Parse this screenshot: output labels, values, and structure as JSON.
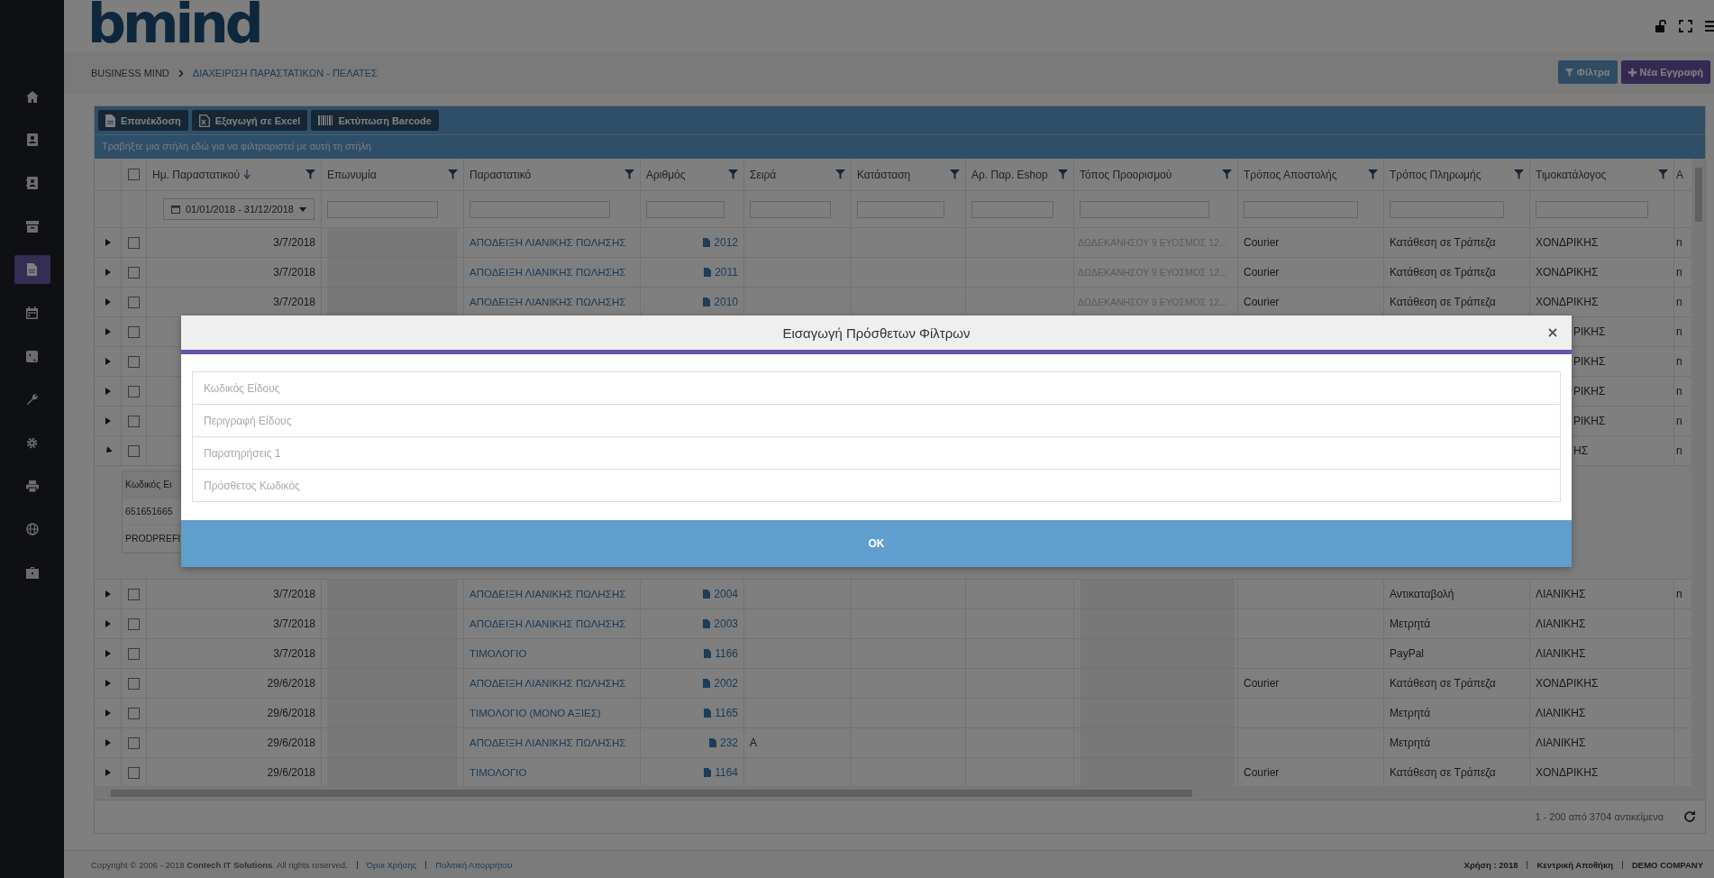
{
  "logo": "bmind",
  "sidebar": [
    {
      "selected": false
    },
    {
      "selected": false
    },
    {
      "selected": false
    },
    {
      "selected": false
    },
    {
      "selected": true
    },
    {
      "selected": false
    },
    {
      "selected": false
    },
    {
      "selected": false
    },
    {
      "selected": false
    },
    {
      "selected": false
    },
    {
      "selected": false
    },
    {
      "selected": false
    }
  ],
  "breadcrumb": [
    "BUSINESS MIND",
    "ΔΙΑΧΕΙΡΙΣΗ ΠΑΡΑΣΤΑΤΙΚΩΝ - ΠΕΛΑΤΕΣ"
  ],
  "actions": [
    {
      "kind": "filter",
      "label": "Φίλτρα"
    },
    {
      "kind": "new",
      "label": "Νέα Εγγραφή"
    }
  ],
  "toolbar": [
    {
      "label": "Επανέκδοση"
    },
    {
      "label": "Εξαγωγή σε Excel"
    },
    {
      "label": "Εκτύπωση Barcode"
    }
  ],
  "group_hint": "Τραβήξτε μια στήλη εδώ για να φιλτραριστεί με αυτή τη στήλη",
  "all_checked": false,
  "date_filter": "01/01/2018 - 31/12/2018",
  "columns": [
    {
      "kind": "date",
      "label": "Ημ. Παραστατικού",
      "sorted": true
    },
    {
      "kind": "name",
      "label": "Επωνυμία",
      "sorted": false
    },
    {
      "kind": "link",
      "label": "Παραστατικό",
      "sorted": false
    },
    {
      "kind": "number",
      "label": "Αριθμός",
      "sorted": false
    },
    {
      "kind": "text",
      "label": "Σειρά",
      "sorted": false
    },
    {
      "kind": "text",
      "label": "Κατάσταση",
      "sorted": false
    },
    {
      "kind": "text",
      "label": "Αρ. Παρ. Eshop",
      "sorted": false
    },
    {
      "kind": "address",
      "label": "Τόπος Προορισμού",
      "sorted": false
    },
    {
      "kind": "text",
      "label": "Τρόπος Αποστολής",
      "sorted": false
    },
    {
      "kind": "text",
      "label": "Τρόπος Πληρωμής",
      "sorted": false
    },
    {
      "kind": "text",
      "label": "Τιμοκατάλογος",
      "sorted": false
    },
    {
      "kind": "cut",
      "label": "Α",
      "sorted": false
    }
  ],
  "rows": [
    {
      "kind": "row",
      "expanded": false,
      "checked": false,
      "cells": [
        "3/7/2018",
        null,
        "ΑΠΟΔΕΙΞΗ ΛΙΑΝΙΚΗΣ ΠΩΛΗΣΗΣ",
        "2012",
        null,
        null,
        null,
        "ΔΩΔΕΚΑΝΗΣΟΥ 9 ΕΥΟΣΜΟΣ 12...",
        "Courier",
        "Κατάθεση σε Τράπεζα",
        "ΧΟΝΔΡΙΚΗΣ",
        "n"
      ]
    },
    {
      "kind": "row",
      "expanded": false,
      "checked": false,
      "cells": [
        "3/7/2018",
        null,
        "ΑΠΟΔΕΙΞΗ ΛΙΑΝΙΚΗΣ ΠΩΛΗΣΗΣ",
        "2011",
        null,
        null,
        null,
        "ΔΩΔΕΚΑΝΗΣΟΥ 9 ΕΥΟΣΜΟΣ 12...",
        "Courier",
        "Κατάθεση σε Τράπεζα",
        "ΧΟΝΔΡΙΚΗΣ",
        "n"
      ]
    },
    {
      "kind": "row",
      "expanded": false,
      "checked": false,
      "cells": [
        "3/7/2018",
        null,
        "ΑΠΟΔΕΙΞΗ ΛΙΑΝΙΚΗΣ ΠΩΛΗΣΗΣ",
        "2010",
        null,
        null,
        null,
        "ΔΩΔΕΚΑΝΗΣΟΥ 9 ΕΥΟΣΜΟΣ 12...",
        "Courier",
        "Κατάθεση σε Τράπεζα",
        "ΧΟΝΔΡΙΚΗΣ",
        "n"
      ]
    },
    {
      "kind": "covered",
      "expanded": false,
      "checked": false,
      "cells": [
        null,
        null,
        null,
        null,
        null,
        null,
        null,
        null,
        null,
        null,
        "ΡΙΚΗΣ",
        "n"
      ]
    },
    {
      "kind": "covered",
      "expanded": false,
      "checked": false,
      "cells": [
        null,
        null,
        null,
        null,
        null,
        null,
        null,
        null,
        null,
        null,
        "ΡΙΚΗΣ",
        "n"
      ]
    },
    {
      "kind": "covered",
      "expanded": false,
      "checked": false,
      "cells": [
        null,
        null,
        null,
        null,
        null,
        null,
        null,
        null,
        null,
        null,
        "ΡΙΚΗΣ",
        "n"
      ]
    },
    {
      "kind": "covered",
      "expanded": false,
      "checked": false,
      "cells": [
        null,
        null,
        null,
        null,
        null,
        null,
        null,
        null,
        null,
        null,
        "ΡΙΚΗΣ",
        "n"
      ]
    },
    {
      "kind": "covered",
      "expanded": true,
      "checked": false,
      "cells": [
        null,
        null,
        null,
        null,
        null,
        null,
        null,
        null,
        null,
        null,
        "ΗΣ",
        "n"
      ]
    },
    {
      "kind": "detail",
      "header": "Κωδικός Ει",
      "cells": [
        "651651665",
        "PRODPREFI"
      ]
    },
    {
      "kind": "row",
      "expanded": false,
      "checked": false,
      "cells": [
        "3/7/2018",
        null,
        "ΑΠΟΔΕΙΞΗ ΛΙΑΝΙΚΗΣ ΠΩΛΗΣΗΣ",
        "2004",
        null,
        null,
        null,
        null,
        null,
        "Αντικαταβολή",
        "ΛΙΑΝΙΚΗΣ",
        "n"
      ]
    },
    {
      "kind": "row",
      "expanded": false,
      "checked": false,
      "cells": [
        "3/7/2018",
        null,
        "ΑΠΟΔΕΙΞΗ ΛΙΑΝΙΚΗΣ ΠΩΛΗΣΗΣ",
        "2003",
        null,
        null,
        null,
        null,
        null,
        "Μετρητά",
        "ΛΙΑΝΙΚΗΣ",
        null
      ]
    },
    {
      "kind": "row",
      "expanded": false,
      "checked": false,
      "cells": [
        "3/7/2018",
        null,
        "ΤΙΜΟΛΟΓΙΟ",
        "1166",
        null,
        null,
        null,
        null,
        null,
        "PayPal",
        "ΛΙΑΝΙΚΗΣ",
        null
      ]
    },
    {
      "kind": "row",
      "expanded": false,
      "checked": false,
      "cells": [
        "29/6/2018",
        null,
        "ΑΠΟΔΕΙΞΗ ΛΙΑΝΙΚΗΣ ΠΩΛΗΣΗΣ",
        "2002",
        null,
        null,
        null,
        null,
        "Courier",
        "Κατάθεση σε Τράπεζα",
        "ΧΟΝΔΡΙΚΗΣ",
        null
      ]
    },
    {
      "kind": "row",
      "expanded": false,
      "checked": false,
      "cells": [
        "29/6/2018",
        null,
        "ΤΙΜΟΛΟΓΙΟ (ΜΟΝΟ ΑΞΙΕΣ)",
        "1165",
        null,
        null,
        null,
        null,
        null,
        "Μετρητά",
        "ΛΙΑΝΙΚΗΣ",
        null
      ]
    },
    {
      "kind": "row",
      "expanded": false,
      "checked": false,
      "cells": [
        "29/6/2018",
        null,
        "ΑΠΟΔΕΙΞΗ ΛΙΑΝΙΚΗΣ ΠΩΛΗΣΗΣ",
        "232",
        "A",
        null,
        null,
        null,
        null,
        "Μετρητά",
        "ΛΙΑΝΙΚΗΣ",
        null
      ]
    },
    {
      "kind": "row",
      "expanded": false,
      "checked": false,
      "cells": [
        "29/6/2018",
        null,
        "ΤΙΜΟΛΟΓΙΟ",
        "1164",
        null,
        null,
        null,
        null,
        "Courier",
        "Κατάθεση σε Τράπεζα",
        "ΧΟΝΔΡΙΚΗΣ",
        null
      ]
    }
  ],
  "pager": "1 - 200 από 3704 αντικείμενα",
  "footer": {
    "copyright": "Copyright © 2006 - 2018 **Contech IT Solutions**. All rights reserved.",
    "links": [
      "Όροι Χρήσης",
      "Πολιτική Απορρήτου"
    ],
    "info": [
      "Χρήση : 2018",
      "Κεντρική Αποθήκη",
      "DEMO COMPANY"
    ]
  },
  "modal": {
    "title": "Εισαγωγή Πρόσθετων Φίλτρων",
    "fields": [
      {
        "placeholder": "Κωδικός Είδους"
      },
      {
        "placeholder": "Περιγραφή Είδους"
      },
      {
        "placeholder": "Παρατηρήσεις 1"
      },
      {
        "placeholder": "Πρόσθετος Κωδικός"
      }
    ],
    "button": "OK"
  }
}
